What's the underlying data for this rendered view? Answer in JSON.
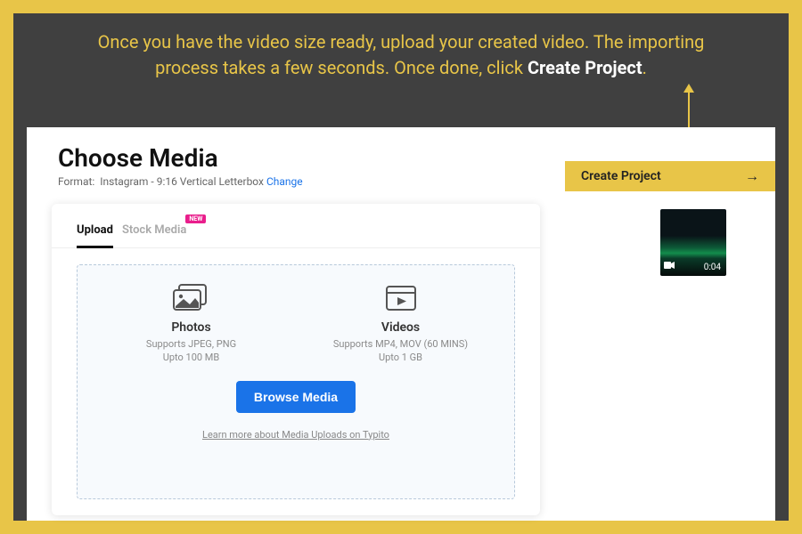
{
  "instruction": {
    "text_before": "Once you have the video size ready, upload your created video. The importing process takes a few seconds. Once done, click ",
    "emphasis": "Create Project",
    "text_after": "."
  },
  "page": {
    "title": "Choose Media",
    "format_label": "Format:",
    "format_value": "Instagram - 9:16 Vertical Letterbox",
    "change_link": "Change"
  },
  "cta": {
    "label": "Create Project"
  },
  "thumbnail": {
    "duration": "0:04"
  },
  "tabs": {
    "upload": "Upload",
    "stock": "Stock Media",
    "stock_badge": "NEW"
  },
  "dropzone": {
    "photos": {
      "title": "Photos",
      "line1": "Supports JPEG, PNG",
      "line2": "Upto 100 MB"
    },
    "videos": {
      "title": "Videos",
      "line1": "Supports MP4, MOV (60 MINS)",
      "line2": "Upto 1 GB"
    },
    "browse_label": "Browse Media",
    "learn_more": "Learn more about Media Uploads on Typito"
  }
}
